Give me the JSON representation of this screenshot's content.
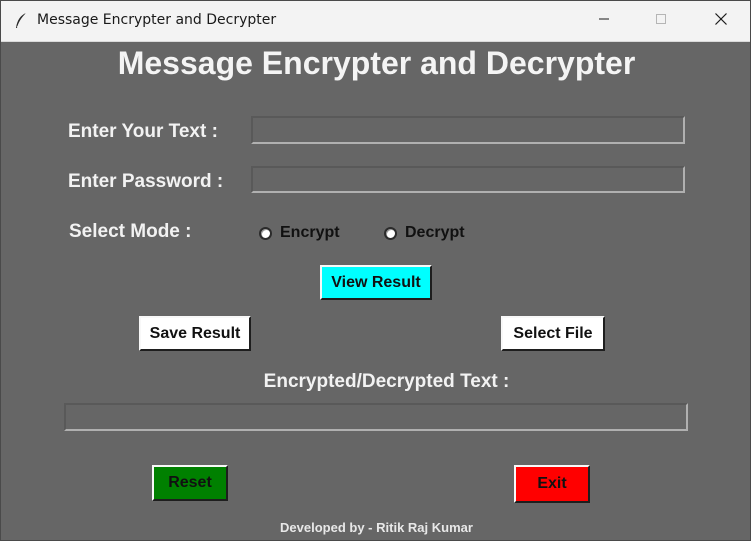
{
  "window": {
    "title": "Message Encrypter and Decrypter"
  },
  "heading": "Message Encrypter and Decrypter",
  "form": {
    "text_label": "Enter Your Text :",
    "text_value": "",
    "password_label": "Enter Password :",
    "password_value": "",
    "mode_label": "Select Mode :",
    "modes": [
      "Encrypt",
      "Decrypt"
    ],
    "selected_mode": null
  },
  "buttons": {
    "view_result": "View Result",
    "save_result": "Save Result",
    "select_file": "Select File",
    "reset": "Reset",
    "exit": "Exit"
  },
  "result": {
    "label": "Encrypted/Decrypted Text :",
    "value": ""
  },
  "footer": "Developed by - Ritik Raj Kumar",
  "colors": {
    "background": "#666666",
    "view_result_button": "#00ffff",
    "reset_button": "#008000",
    "exit_button": "#ff0000",
    "neutral_button": "#ffffff"
  },
  "icons": {
    "app": "feather-icon",
    "minimize": "minimize-icon",
    "maximize": "maximize-icon",
    "close": "close-icon"
  }
}
